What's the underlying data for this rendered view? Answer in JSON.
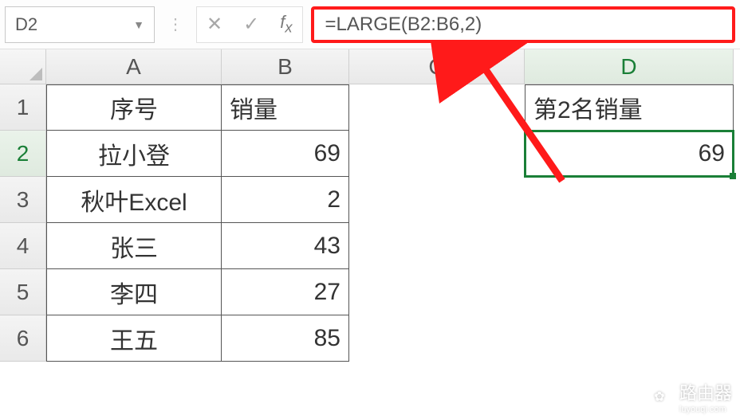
{
  "formula_bar": {
    "cell_ref": "D2",
    "formula": "=LARGE(B2:B6,2)"
  },
  "columns": {
    "A": "A",
    "B": "B",
    "C": "C",
    "D": "D"
  },
  "row_nums": [
    "1",
    "2",
    "3",
    "4",
    "5",
    "6"
  ],
  "table": {
    "headers": {
      "A": "序号",
      "B": "销量"
    },
    "rows": [
      {
        "A": "拉小登",
        "B": "69"
      },
      {
        "A": "秋叶Excel",
        "B": "2"
      },
      {
        "A": "张三",
        "B": "43"
      },
      {
        "A": "李四",
        "B": "27"
      },
      {
        "A": "王五",
        "B": "85"
      }
    ]
  },
  "result": {
    "label": "第2名销量",
    "value": "69"
  },
  "watermark": {
    "text": "路由器",
    "sub": "luyouqi.com"
  }
}
